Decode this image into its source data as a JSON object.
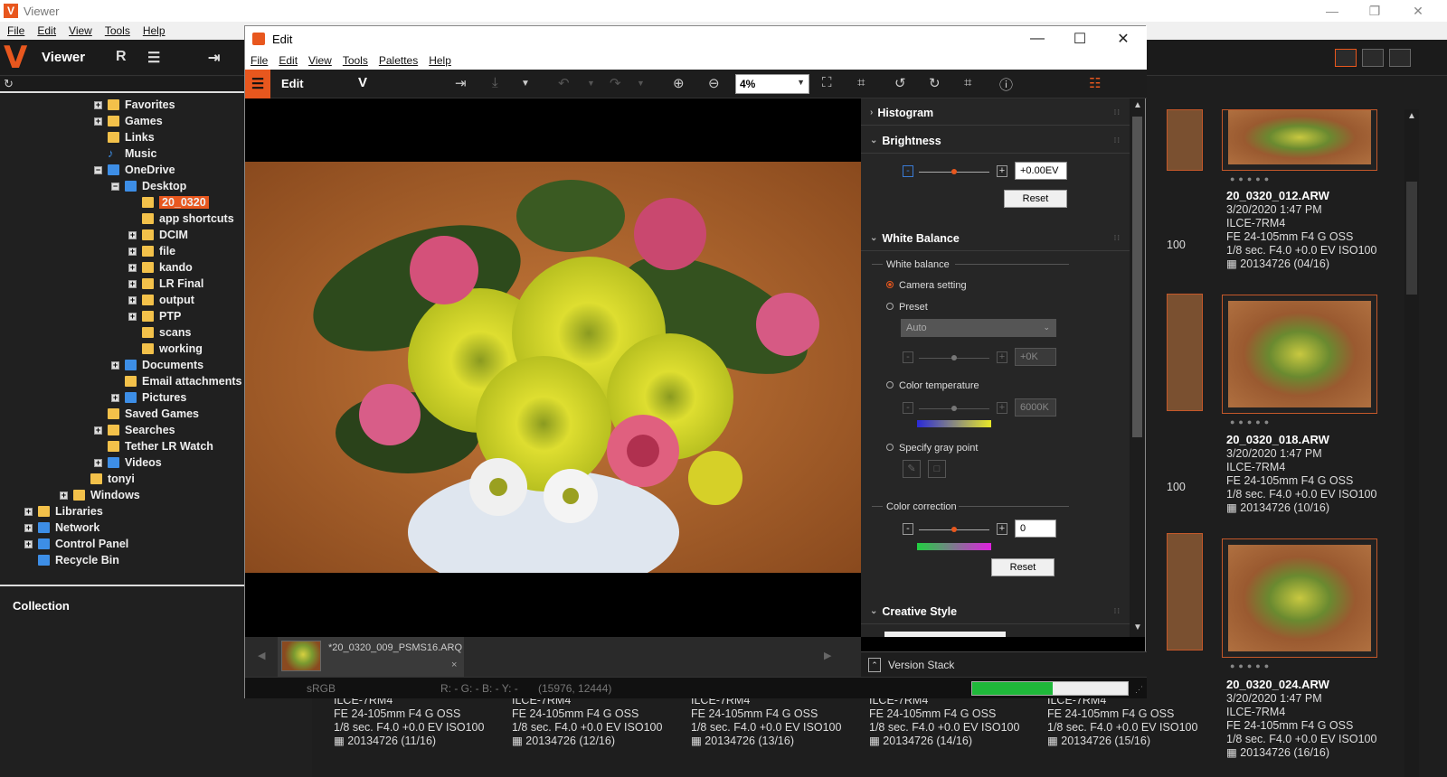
{
  "outer": {
    "title": "Viewer",
    "logo": "V",
    "menu": [
      "File",
      "Edit",
      "View",
      "Tools",
      "Help"
    ],
    "viewer_label": "Viewer",
    "min_icon": "—",
    "restore_icon": "❐",
    "close_icon": "✕"
  },
  "tree": [
    {
      "label": "Favorites",
      "indent": 6,
      "exp": "+",
      "type": "folder"
    },
    {
      "label": "Games",
      "indent": 6,
      "exp": "+",
      "type": "folder"
    },
    {
      "label": "Links",
      "indent": 6,
      "exp": "",
      "type": "folder"
    },
    {
      "label": "Music",
      "indent": 6,
      "exp": "",
      "type": "music"
    },
    {
      "label": "OneDrive",
      "indent": 6,
      "exp": "−",
      "type": "blue"
    },
    {
      "label": "Desktop",
      "indent": 7,
      "exp": "−",
      "type": "blue"
    },
    {
      "label": "20_0320",
      "indent": 8,
      "exp": "",
      "type": "folder",
      "selected": true
    },
    {
      "label": "app shortcuts",
      "indent": 8,
      "exp": "",
      "type": "folder"
    },
    {
      "label": "DCIM",
      "indent": 8,
      "exp": "+",
      "type": "folder"
    },
    {
      "label": "file",
      "indent": 8,
      "exp": "+",
      "type": "folder"
    },
    {
      "label": "kando",
      "indent": 8,
      "exp": "+",
      "type": "folder"
    },
    {
      "label": "LR Final",
      "indent": 8,
      "exp": "+",
      "type": "folder"
    },
    {
      "label": "output",
      "indent": 8,
      "exp": "+",
      "type": "folder"
    },
    {
      "label": "PTP",
      "indent": 8,
      "exp": "+",
      "type": "folder"
    },
    {
      "label": "scans",
      "indent": 8,
      "exp": "",
      "type": "folder"
    },
    {
      "label": "working",
      "indent": 8,
      "exp": "",
      "type": "folder"
    },
    {
      "label": "Documents",
      "indent": 7,
      "exp": "+",
      "type": "blue"
    },
    {
      "label": "Email attachments",
      "indent": 7,
      "exp": "",
      "type": "folder"
    },
    {
      "label": "Pictures",
      "indent": 7,
      "exp": "+",
      "type": "blue"
    },
    {
      "label": "Saved Games",
      "indent": 6,
      "exp": "",
      "type": "folder"
    },
    {
      "label": "Searches",
      "indent": 6,
      "exp": "+",
      "type": "folder"
    },
    {
      "label": "Tether LR Watch",
      "indent": 6,
      "exp": "",
      "type": "folder"
    },
    {
      "label": "Videos",
      "indent": 6,
      "exp": "+",
      "type": "blue"
    },
    {
      "label": "tonyi",
      "indent": 5,
      "exp": "",
      "type": "folder"
    },
    {
      "label": "Windows",
      "indent": 4,
      "exp": "+",
      "type": "folder"
    },
    {
      "label": "Libraries",
      "indent": 1,
      "exp": "+",
      "type": "folder"
    },
    {
      "label": "Network",
      "indent": 1,
      "exp": "+",
      "type": "blue"
    },
    {
      "label": "Control Panel",
      "indent": 1,
      "exp": "+",
      "type": "blue"
    },
    {
      "label": "Recycle Bin",
      "indent": 1,
      "exp": "",
      "type": "blue"
    }
  ],
  "collection_label": "Collection",
  "thumbs": [
    {
      "name": "20_0320_012.ARW",
      "date": "3/20/2020 1:47 PM",
      "camera": "ILCE-7RM4",
      "lens": "FE 24-105mm F4 G OSS",
      "exposure": "1/8 sec. F4.0 +0.0 EV ISO100",
      "stack": "20134726 (04/16)"
    },
    {
      "name": "20_0320_018.ARW",
      "date": "3/20/2020 1:47 PM",
      "camera": "ILCE-7RM4",
      "lens": "FE 24-105mm F4 G OSS",
      "exposure": "1/8 sec. F4.0 +0.0 EV ISO100",
      "stack": "20134726 (10/16)"
    },
    {
      "name": "20_0320_024.ARW",
      "date": "3/20/2020 1:47 PM",
      "camera": "ILCE-7RM4",
      "lens": "FE 24-105mm F4 G OSS",
      "exposure": "1/8 sec. F4.0 +0.0 EV ISO100",
      "stack": "20134726 (16/16)"
    }
  ],
  "partial_iso": [
    "100",
    "100"
  ],
  "bottom_row": [
    {
      "camera": "ILCE-7RM4",
      "lens": "FE 24-105mm F4 G OSS",
      "exposure": "1/8 sec. F4.0 +0.0 EV ISO100",
      "stack": "20134726 (11/16)"
    },
    {
      "camera": "ILCE-7RM4",
      "lens": "FE 24-105mm F4 G OSS",
      "exposure": "1/8 sec. F4.0 +0.0 EV ISO100",
      "stack": "20134726 (12/16)"
    },
    {
      "camera": "ILCE-7RM4",
      "lens": "FE 24-105mm F4 G OSS",
      "exposure": "1/8 sec. F4.0 +0.0 EV ISO100",
      "stack": "20134726 (13/16)"
    },
    {
      "camera": "ILCE-7RM4",
      "lens": "FE 24-105mm F4 G OSS",
      "exposure": "1/8 sec. F4.0 +0.0 EV ISO100",
      "stack": "20134726 (14/16)"
    },
    {
      "camera": "ILCE-7RM4",
      "lens": "FE 24-105mm F4 G OSS",
      "exposure": "1/8 sec. F4.0 +0.0 EV ISO100",
      "stack": "20134726 (15/16)"
    }
  ],
  "edit": {
    "title": "Edit",
    "menu": [
      "File",
      "Edit",
      "View",
      "Tools",
      "Palettes",
      "Help"
    ],
    "toolbar_label": "Edit",
    "zoom": "4%",
    "film_name": "*20_0320_009_PSMS16.ARQ",
    "film_close": "×",
    "status": {
      "color_space": "sRGB",
      "rgb": "R: -  G: -  B: -  Y: -",
      "coords": "(15976, 12444)"
    },
    "progress": 0.52,
    "version_stack": "Version Stack"
  },
  "palette": {
    "histogram": "Histogram",
    "brightness": "Brightness",
    "brightness_value": "+0.00EV",
    "reset": "Reset",
    "white_balance": "White Balance",
    "wb_group": "White balance",
    "camera_setting": "Camera setting",
    "preset": "Preset",
    "preset_value": "Auto",
    "preset_k": "+0K",
    "color_temp": "Color temperature",
    "color_temp_value": "6000K",
    "gray_point": "Specify gray point",
    "color_correction": "Color correction",
    "cc_value": "0",
    "creative_style": "Creative Style"
  },
  "colors": {
    "accent": "#e8571e",
    "progress": "#1fb83a"
  }
}
